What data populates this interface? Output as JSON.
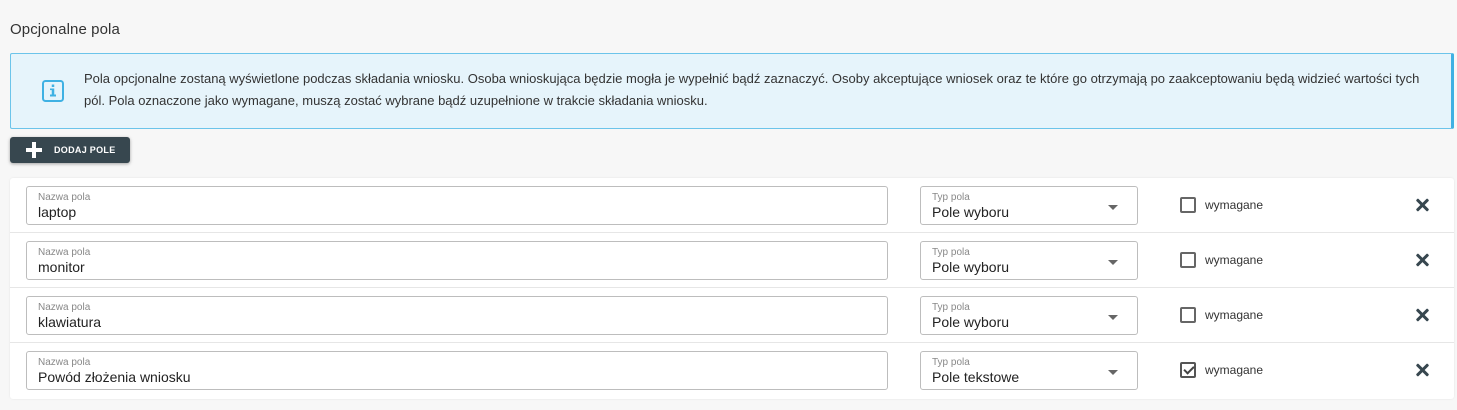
{
  "section": {
    "title": "Opcjonalne pola"
  },
  "info": {
    "icon": "info-icon",
    "accent": "#3fb1e3",
    "text": "Pola opcjonalne zostaną wyświetlone podczas składania wniosku. Osoba wnioskująca będzie mogła je wypełnić bądź zaznaczyć. Osoby akceptujące wniosek oraz te które go otrzymają po zaakceptowaniu będą widzieć wartości tych pól. Pola oznaczone jako wymagane, muszą zostać wybrane bądź uzupełnione w trakcie składania wniosku."
  },
  "toolbar": {
    "add_label": "DODAJ POLE",
    "add_icon": "plus-icon",
    "button_color": "#37474f"
  },
  "fields": [
    {
      "name_label": "Nazwa pola",
      "name_value": "laptop",
      "type_label": "Typ pola",
      "type_value": "Pole wyboru",
      "required_label": "wymagane",
      "required": false
    },
    {
      "name_label": "Nazwa pola",
      "name_value": "monitor",
      "type_label": "Typ pola",
      "type_value": "Pole wyboru",
      "required_label": "wymagane",
      "required": false
    },
    {
      "name_label": "Nazwa pola",
      "name_value": "klawiatura",
      "type_label": "Typ pola",
      "type_value": "Pole wyboru",
      "required_label": "wymagane",
      "required": false
    },
    {
      "name_label": "Nazwa pola",
      "name_value": "Powód złożenia wniosku",
      "type_label": "Typ pola",
      "type_value": "Pole tekstowe",
      "required_label": "wymagane",
      "required": true
    }
  ]
}
